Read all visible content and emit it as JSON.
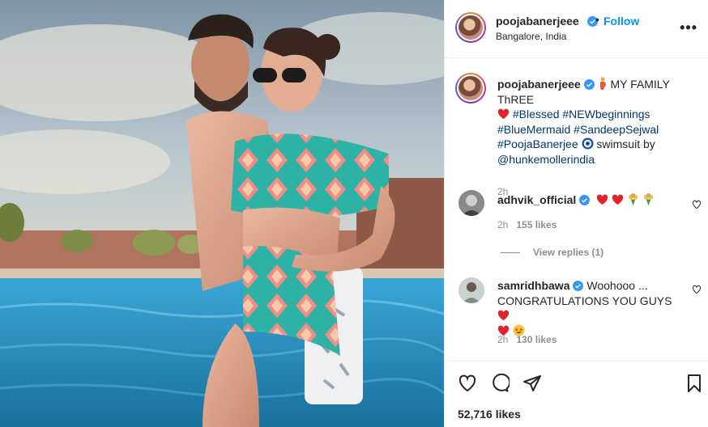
{
  "post": {
    "username": "poojabanerjeee",
    "follow_label": "Follow",
    "dot": "•",
    "location": "Bangalore, India",
    "more_label": "•••"
  },
  "caption": {
    "username": "poojabanerjeee",
    "text1": "MY FAMILY ThREE",
    "tag_blessed": "#Blessed",
    "tag_new": "#NEWbeginnings",
    "tag_mermaid": "#BlueMermaid",
    "tag_sandeep": "#SandeepSejwal",
    "tag_pooja": "#PoojaBanerjee",
    "text2": "swimsuit by",
    "mention": "@hunkemollerindia",
    "time": "2h"
  },
  "comments": [
    {
      "username": "adhvik_official",
      "text": "",
      "time": "2h",
      "likes": "155 likes"
    },
    {
      "username": "samridhbawa",
      "text": "Woohooo ... CONGRATULATIONS YOU GUYS",
      "text_a": "Woohooo ...",
      "text_b": "CONGRATULATIONS YOU GUYS",
      "time": "2h",
      "likes": "130 likes"
    }
  ],
  "view_replies": "View replies (1)",
  "likes_count": "52,716 likes",
  "colors": {
    "accent": "#0095f6",
    "verified": "#3897f0",
    "heart": "#ed4956",
    "hashtag": "#00376b",
    "muted": "#8e8e8e"
  },
  "icons": [
    "verified-badge-icon",
    "heart-icon",
    "comment-icon",
    "share-icon",
    "bookmark-icon",
    "more-options-icon"
  ]
}
